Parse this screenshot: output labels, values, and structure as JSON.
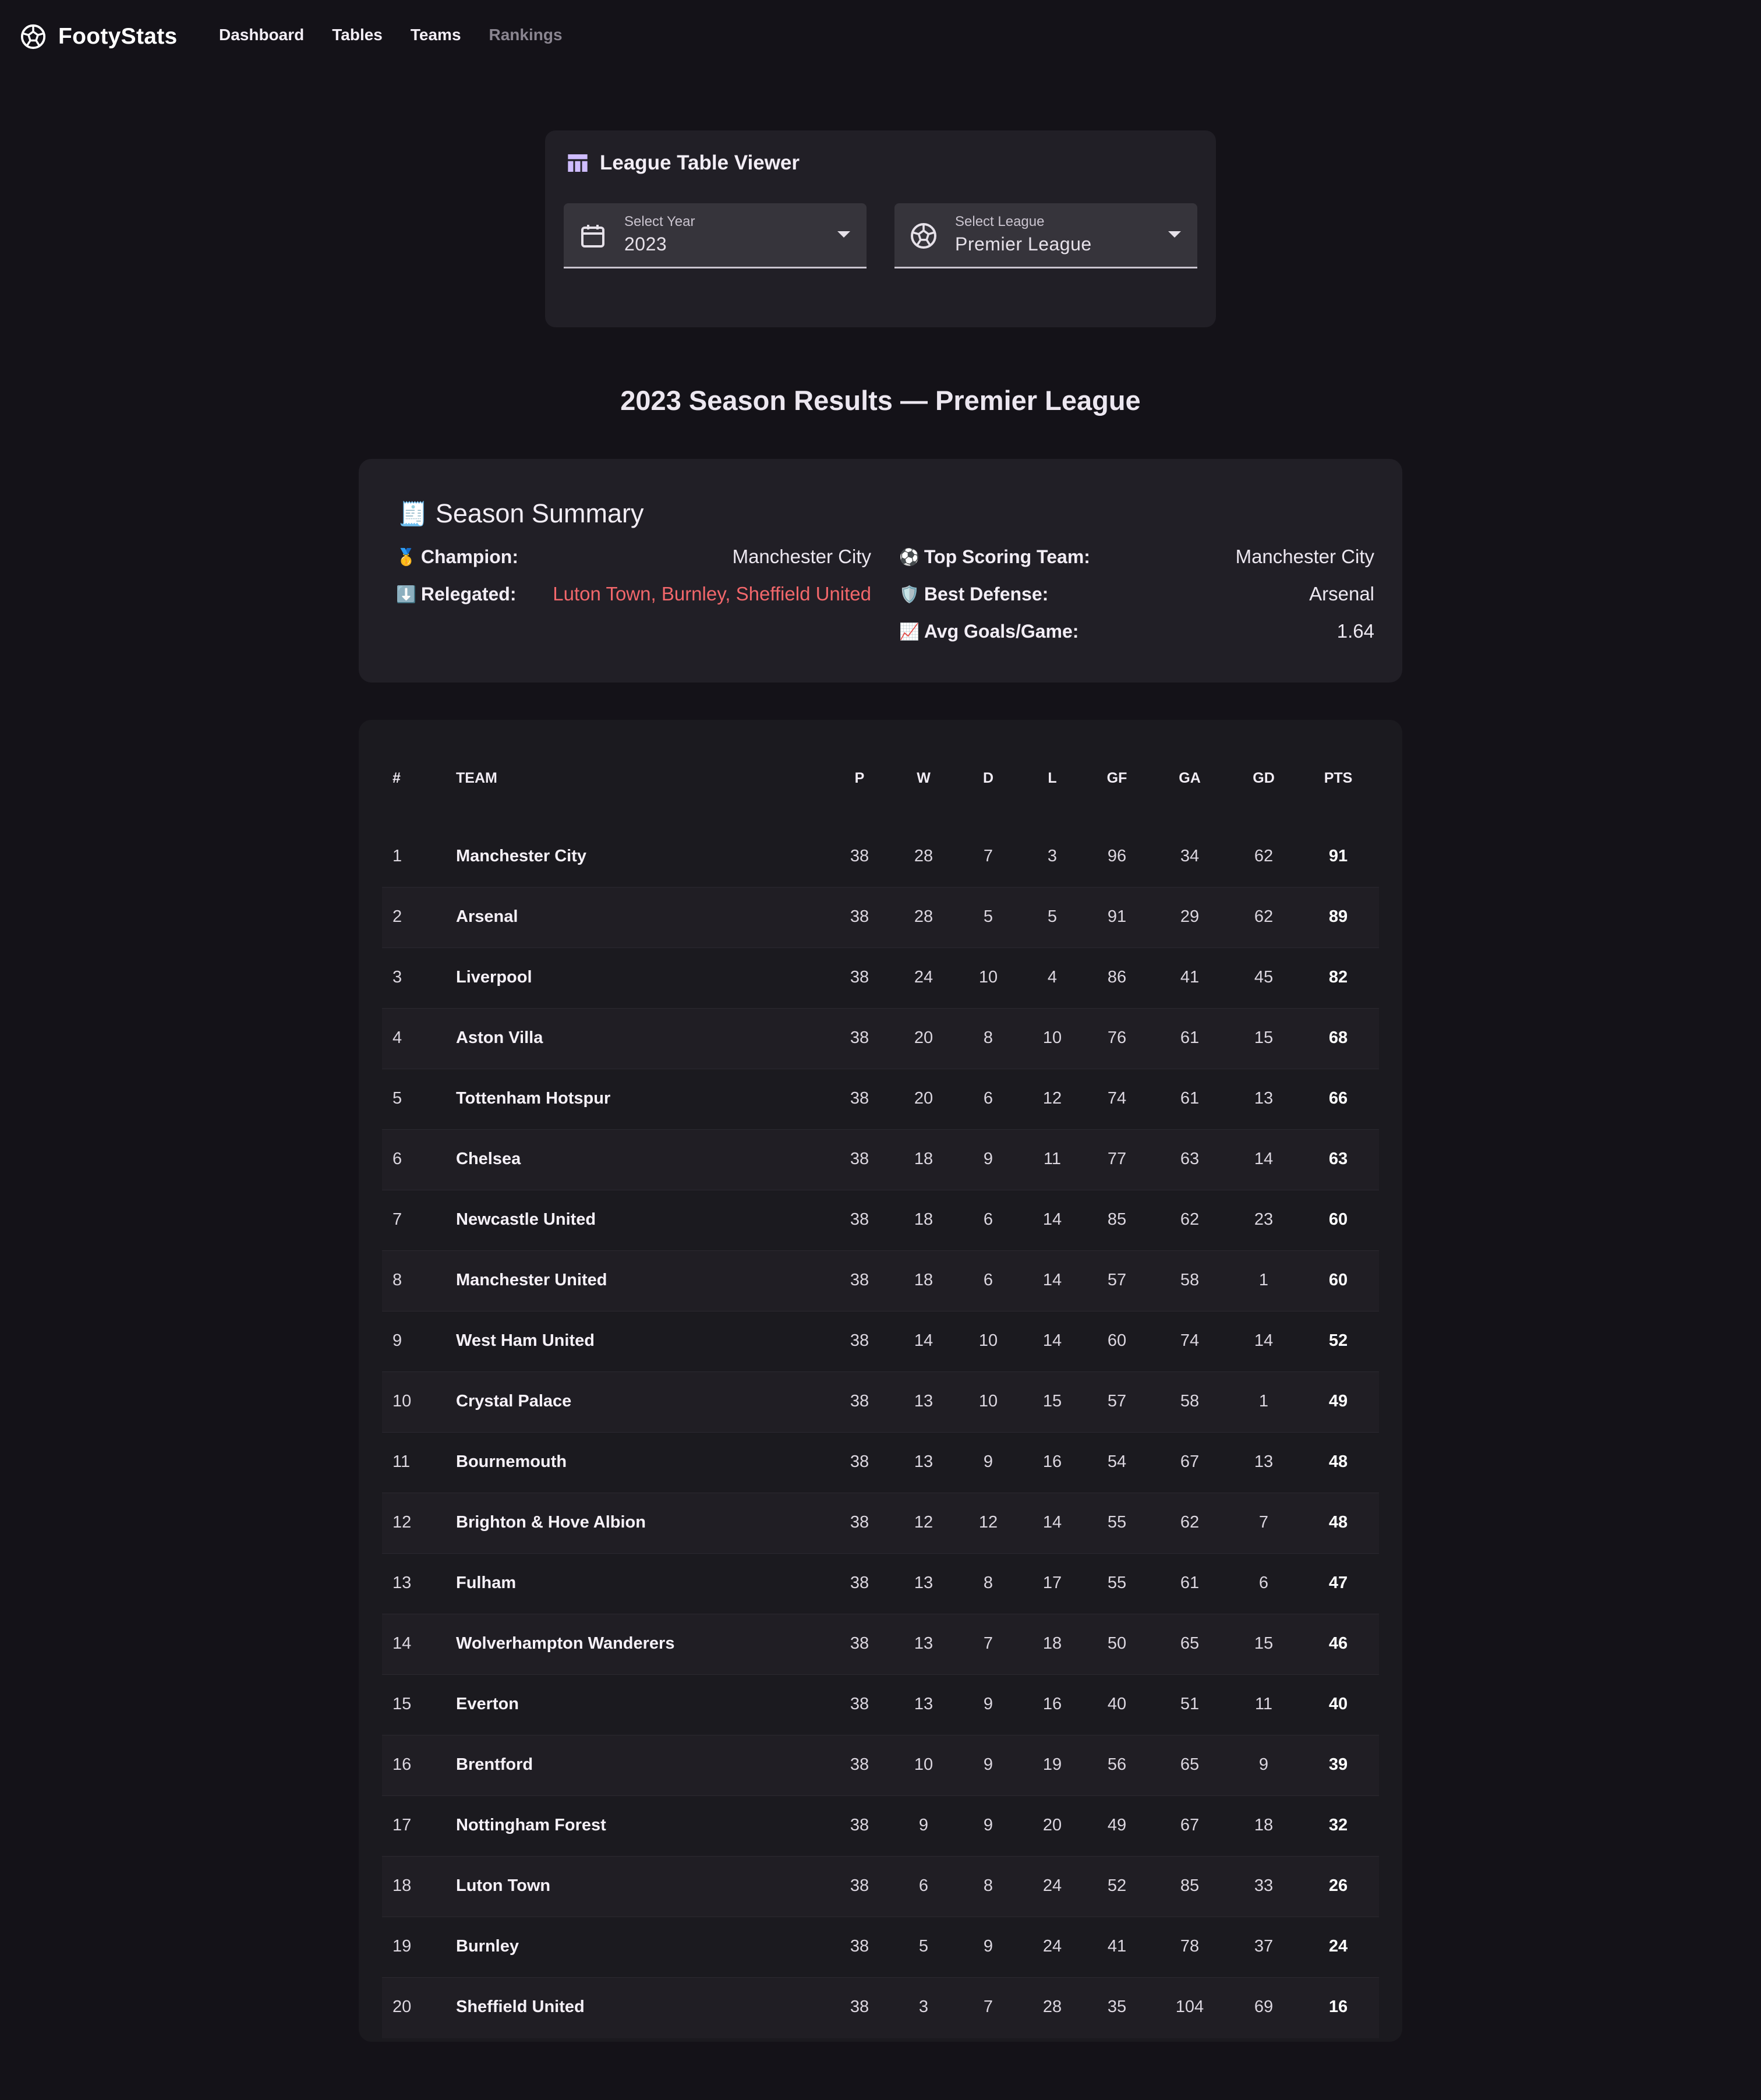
{
  "app": {
    "name": "FootyStats",
    "nav": [
      "Dashboard",
      "Tables",
      "Teams",
      "Rankings"
    ]
  },
  "viewer": {
    "title": "League Table Viewer",
    "year": {
      "label": "Select Year",
      "value": "2023"
    },
    "league": {
      "label": "Select League",
      "value": "Premier League"
    }
  },
  "season_heading": "2023 Season Results — Premier League",
  "summary": {
    "title": "Season Summary",
    "title_icon": "🧾",
    "champion": {
      "icon": "🥇",
      "label": "Champion:",
      "value": "Manchester City"
    },
    "relegated": {
      "icon": "⬇️",
      "label": "Relegated:",
      "value": "Luton Town, Burnley, Sheffield United"
    },
    "top_scoring": {
      "icon": "⚽",
      "label": "Top Scoring Team:",
      "value": "Manchester City"
    },
    "best_defense": {
      "icon": "🛡️",
      "label": "Best Defense:",
      "value": "Arsenal"
    },
    "avg_goals": {
      "icon": "📈",
      "label": "Avg Goals/Game:",
      "value": "1.64"
    },
    "relegated_color": "#f2676b"
  },
  "table": {
    "columns": [
      "#",
      "Team",
      "P",
      "W",
      "D",
      "L",
      "GF",
      "GA",
      "GD",
      "PTS"
    ],
    "rows": [
      [
        "1",
        "Manchester City",
        "38",
        "28",
        "7",
        "3",
        "96",
        "34",
        "62",
        "91"
      ],
      [
        "2",
        "Arsenal",
        "38",
        "28",
        "5",
        "5",
        "91",
        "29",
        "62",
        "89"
      ],
      [
        "3",
        "Liverpool",
        "38",
        "24",
        "10",
        "4",
        "86",
        "41",
        "45",
        "82"
      ],
      [
        "4",
        "Aston Villa",
        "38",
        "20",
        "8",
        "10",
        "76",
        "61",
        "15",
        "68"
      ],
      [
        "5",
        "Tottenham Hotspur",
        "38",
        "20",
        "6",
        "12",
        "74",
        "61",
        "13",
        "66"
      ],
      [
        "6",
        "Chelsea",
        "38",
        "18",
        "9",
        "11",
        "77",
        "63",
        "14",
        "63"
      ],
      [
        "7",
        "Newcastle United",
        "38",
        "18",
        "6",
        "14",
        "85",
        "62",
        "23",
        "60"
      ],
      [
        "8",
        "Manchester United",
        "38",
        "18",
        "6",
        "14",
        "57",
        "58",
        "1",
        "60"
      ],
      [
        "9",
        "West Ham United",
        "38",
        "14",
        "10",
        "14",
        "60",
        "74",
        "14",
        "52"
      ],
      [
        "10",
        "Crystal Palace",
        "38",
        "13",
        "10",
        "15",
        "57",
        "58",
        "1",
        "49"
      ],
      [
        "11",
        "Bournemouth",
        "38",
        "13",
        "9",
        "16",
        "54",
        "67",
        "13",
        "48"
      ],
      [
        "12",
        "Brighton & Hove Albion",
        "38",
        "12",
        "12",
        "14",
        "55",
        "62",
        "7",
        "48"
      ],
      [
        "13",
        "Fulham",
        "38",
        "13",
        "8",
        "17",
        "55",
        "61",
        "6",
        "47"
      ],
      [
        "14",
        "Wolverhampton Wanderers",
        "38",
        "13",
        "7",
        "18",
        "50",
        "65",
        "15",
        "46"
      ],
      [
        "15",
        "Everton",
        "38",
        "13",
        "9",
        "16",
        "40",
        "51",
        "11",
        "40"
      ],
      [
        "16",
        "Brentford",
        "38",
        "10",
        "9",
        "19",
        "56",
        "65",
        "9",
        "39"
      ],
      [
        "17",
        "Nottingham Forest",
        "38",
        "9",
        "9",
        "20",
        "49",
        "67",
        "18",
        "32"
      ],
      [
        "18",
        "Luton Town",
        "38",
        "6",
        "8",
        "24",
        "52",
        "85",
        "33",
        "26"
      ],
      [
        "19",
        "Burnley",
        "38",
        "5",
        "9",
        "24",
        "41",
        "78",
        "37",
        "24"
      ],
      [
        "20",
        "Sheffield United",
        "38",
        "3",
        "7",
        "28",
        "35",
        "104",
        "69",
        "16"
      ]
    ]
  }
}
